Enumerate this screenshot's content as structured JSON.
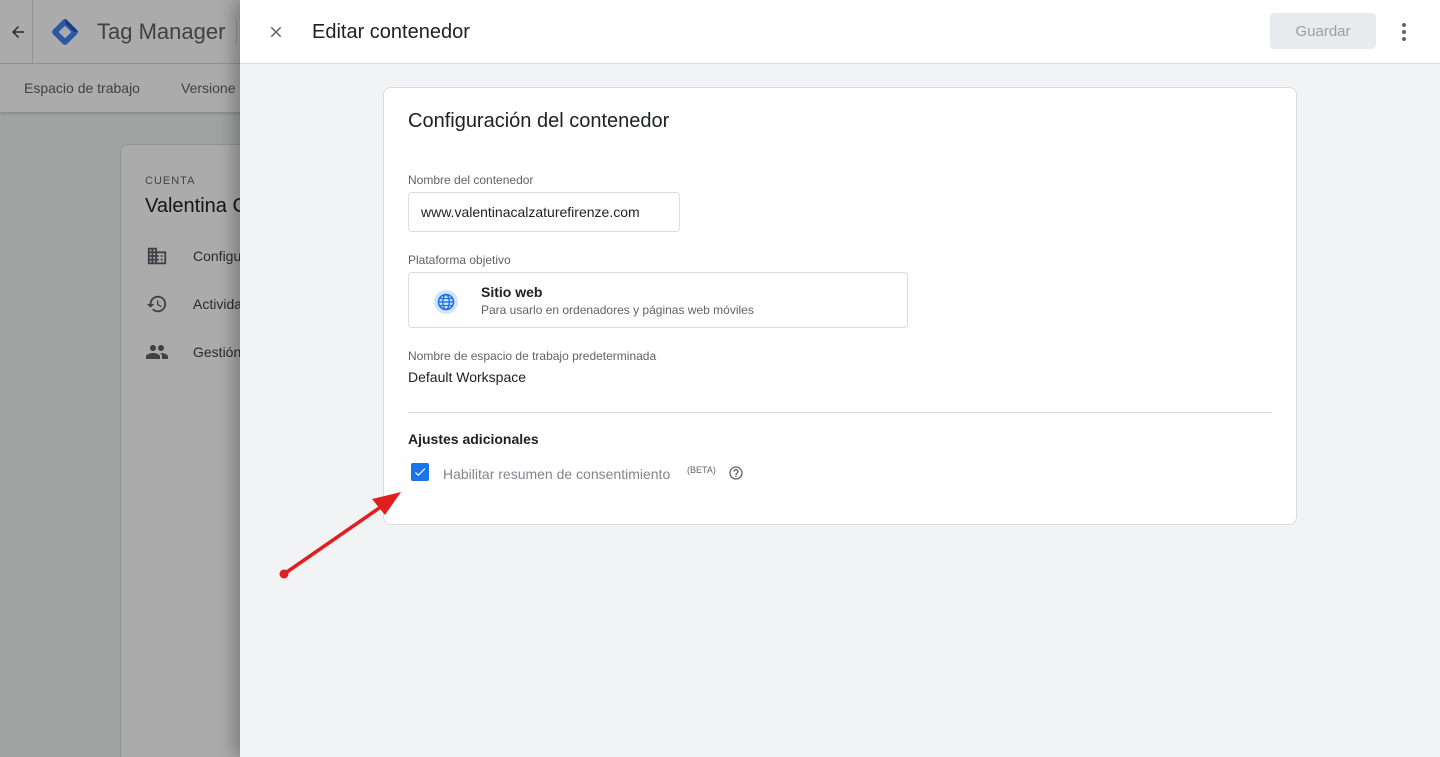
{
  "background_app": {
    "product_name": "Tag Manager",
    "nav_items": [
      "Espacio de trabajo",
      "Versione"
    ],
    "account_eyebrow": "CUENTA",
    "account_name": "Valentina C",
    "menu_items": [
      {
        "label": "Configu",
        "icon": "building-icon"
      },
      {
        "label": "Activida",
        "icon": "history-icon"
      },
      {
        "label": "Gestión",
        "icon": "people-icon"
      }
    ]
  },
  "sheet": {
    "title": "Editar contenedor",
    "save_label": "Guardar",
    "close_icon": "close-icon",
    "more_icon": "more-vert-icon"
  },
  "container_settings": {
    "title": "Configuración del contenedor",
    "name_label": "Nombre del contenedor",
    "name_value": "www.valentinacalzaturefirenze.com",
    "platform_label": "Plataforma objetivo",
    "platform": {
      "title": "Sitio web",
      "description": "Para usarlo en ordenadores y páginas web móviles",
      "icon": "globe-icon"
    },
    "workspace_label": "Nombre de espacio de trabajo predeterminada",
    "workspace_value": "Default Workspace",
    "additional_title": "Ajustes adicionales",
    "consent_label": "Habilitar resumen de consentimiento",
    "consent_badge": "(BETA)",
    "consent_checked": true
  },
  "colors": {
    "accent": "#1a73e8",
    "annotation_arrow": "#e02020"
  }
}
